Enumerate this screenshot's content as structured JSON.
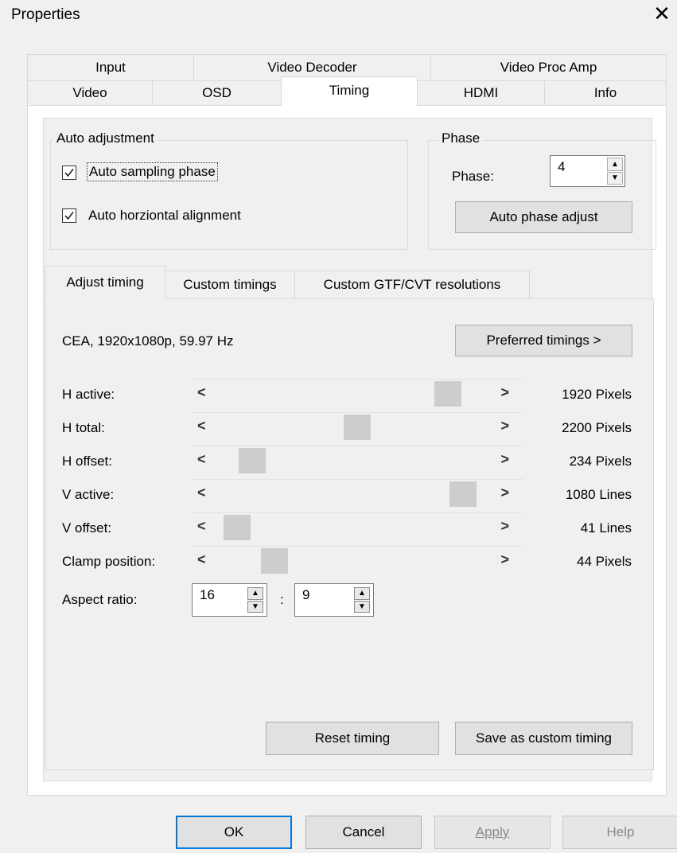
{
  "window": {
    "title": "Properties",
    "close_glyph": "✕"
  },
  "tabs_row1": [
    "Input",
    "Video Decoder",
    "Video Proc Amp"
  ],
  "tabs_row2": [
    "Video",
    "OSD",
    "Timing",
    "HDMI",
    "Info"
  ],
  "active_tab": "Timing",
  "auto_adjustment": {
    "legend": "Auto adjustment",
    "items": [
      {
        "label": "Auto sampling phase",
        "checked": true
      },
      {
        "label": "Auto horziontal alignment",
        "checked": true
      }
    ]
  },
  "phase": {
    "legend": "Phase",
    "label": "Phase:",
    "value": "4",
    "button": "Auto phase adjust"
  },
  "subtabs": [
    "Adjust timing",
    "Custom timings",
    "Custom GTF/CVT resolutions"
  ],
  "active_subtab": "Adjust timing",
  "mode_text": "CEA, 1920x1080p, 59.97 Hz",
  "preferred_button": "Preferred timings >",
  "rows": [
    {
      "label": "H active:",
      "value": "1920 Pixels",
      "fraction": 0.88
    },
    {
      "label": "H total:",
      "value": "2200 Pixels",
      "fraction": 0.52
    },
    {
      "label": "H offset:",
      "value": "234 Pixels",
      "fraction": 0.1
    },
    {
      "label": "V active:",
      "value": "1080 Lines",
      "fraction": 0.94
    },
    {
      "label": "V offset:",
      "value": "41 Lines",
      "fraction": 0.04
    },
    {
      "label": "Clamp position:",
      "value": "44 Pixels",
      "fraction": 0.19
    }
  ],
  "slider_left_glyph": "<",
  "slider_right_glyph": ">",
  "aspect": {
    "label": "Aspect ratio:",
    "w": "16",
    "separator": ":",
    "h": "9"
  },
  "reset_button": "Reset timing",
  "save_button": "Save as custom timing",
  "footer": {
    "ok": "OK",
    "cancel": "Cancel",
    "apply": "Apply",
    "help": "Help"
  },
  "colors": {
    "accent": "#0078d7",
    "thumb": "#cdcdcd",
    "background": "#f0f0f0"
  }
}
